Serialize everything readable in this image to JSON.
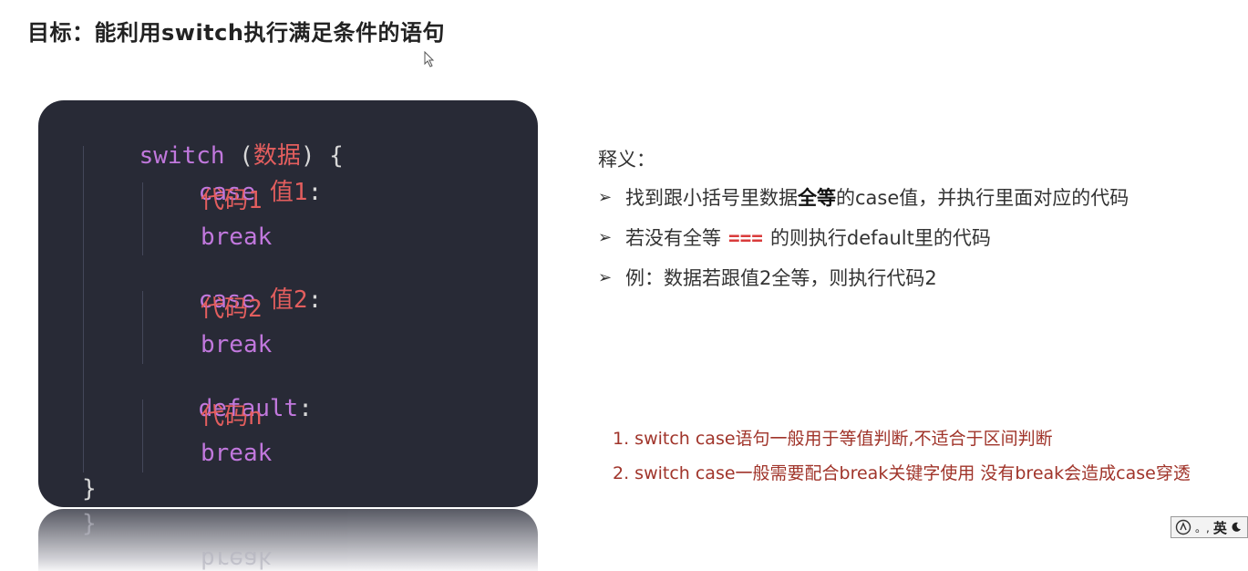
{
  "title": "目标：能利用switch执行满足条件的语句",
  "code": {
    "line1": {
      "kw": "switch",
      "open": " (",
      "expr": "数据",
      "close": ") {"
    },
    "line2": {
      "kw": "case",
      "val": "值1",
      "colon": ":"
    },
    "line3": {
      "code": "代码1"
    },
    "line4": {
      "kw": "break"
    },
    "line5": {
      "kw": "case",
      "val": "值2",
      "colon": ":"
    },
    "line6": {
      "code": "代码2"
    },
    "line7": {
      "kw": "break"
    },
    "line8": {
      "kw": "default",
      "colon": ":"
    },
    "line9": {
      "code": "代码n"
    },
    "line10": {
      "kw": "break"
    },
    "line11": {
      "brace": "}"
    }
  },
  "reflection": {
    "brace": "}",
    "kw": "break"
  },
  "explanation": {
    "heading": "释义：",
    "item1": {
      "before": "找到跟小括号里数据",
      "bold": "全等",
      "after": "的case值，并执行里面对应的代码"
    },
    "item2": {
      "before": "若没有全等",
      "op": "===",
      "after": "的则执行default里的代码"
    },
    "item3": {
      "text": "例：数据若跟值2全等，则执行代码2"
    }
  },
  "notes": [
    "1. switch case语句一般用于等值判断,不适合于区间判断",
    "2. switch case一般需要配合break关键字使用 没有break会造成case穿透"
  ],
  "ime": {
    "label": "英",
    "icons": [
      "ime-logo-icon",
      "punctuation-icon",
      "moon-icon"
    ]
  }
}
